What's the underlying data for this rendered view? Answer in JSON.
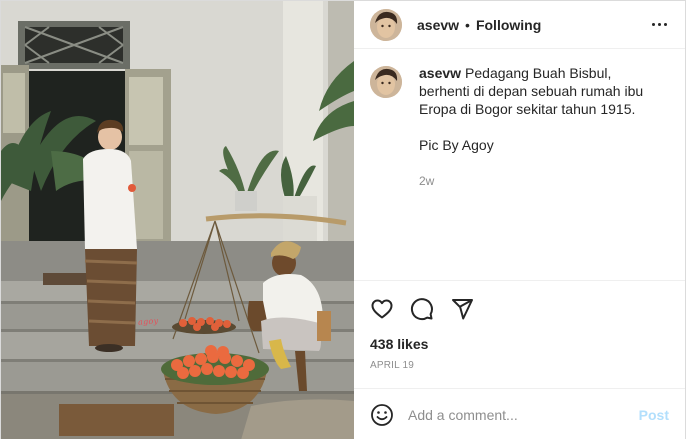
{
  "post": {
    "author": "asevw",
    "header_separator": "•",
    "follow_status": "Following",
    "photo_signature": "agoy",
    "caption": {
      "username": "asevw",
      "text": "Pedagang Buah Bisbul, berhenti di depan sebuah rumah ibu Eropa di Bogor sekitar tahun 1915.",
      "credit": "Pic By Agoy",
      "time_ago": "2w"
    },
    "likes": "438 likes",
    "date": "APRIL 19",
    "comment_box": {
      "placeholder": "Add a comment...",
      "post_label": "Post"
    }
  },
  "icons": {
    "more": "more-options-icon",
    "like": "heart-icon",
    "comment": "comment-bubble-icon",
    "share": "paper-plane-icon",
    "emoji": "emoji-icon"
  },
  "colors": {
    "text": "#262626",
    "secondary": "#8e8e8e",
    "divider": "#efefef",
    "post_disabled": "#b2dffc"
  }
}
